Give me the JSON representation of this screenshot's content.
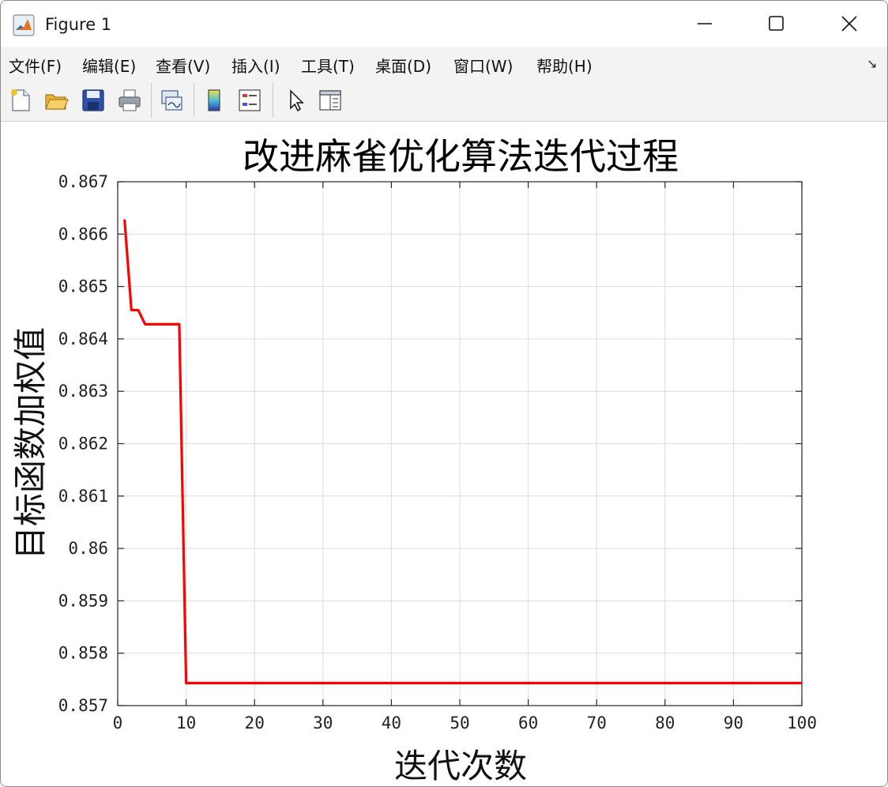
{
  "window": {
    "title": "Figure 1",
    "icon": "matlab-icon"
  },
  "menu": [
    {
      "label": "文件(F)"
    },
    {
      "label": "编辑(E)"
    },
    {
      "label": "查看(V)"
    },
    {
      "label": "插入(I)"
    },
    {
      "label": "工具(T)"
    },
    {
      "label": "桌面(D)"
    },
    {
      "label": "窗口(W)"
    },
    {
      "label": "帮助(H)"
    }
  ],
  "toolbar": [
    {
      "name": "new-figure-icon"
    },
    {
      "name": "open-file-icon"
    },
    {
      "name": "save-icon"
    },
    {
      "name": "print-icon"
    },
    {
      "name": "link-plot-icon"
    },
    {
      "name": "colorbar-icon"
    },
    {
      "name": "legend-icon"
    },
    {
      "name": "pointer-icon"
    },
    {
      "name": "property-inspector-icon"
    }
  ],
  "chart_data": {
    "type": "line",
    "title": "改进麻雀优化算法迭代过程",
    "xlabel": "迭代次数",
    "ylabel": "目标函数加权值",
    "xlim": [
      0,
      100
    ],
    "ylim": [
      0.857,
      0.867
    ],
    "xticks": [
      0,
      10,
      20,
      30,
      40,
      50,
      60,
      70,
      80,
      90,
      100
    ],
    "xtick_labels": [
      "0",
      "10",
      "20",
      "30",
      "40",
      "50",
      "60",
      "70",
      "80",
      "90",
      "100"
    ],
    "yticks": [
      0.857,
      0.858,
      0.859,
      0.86,
      0.861,
      0.862,
      0.863,
      0.864,
      0.865,
      0.866,
      0.867
    ],
    "ytick_labels": [
      "0.857",
      "0.858",
      "0.859",
      "0.86",
      "0.861",
      "0.862",
      "0.863",
      "0.864",
      "0.865",
      "0.866",
      "0.867"
    ],
    "grid": true,
    "series": [
      {
        "color": "#ff0000",
        "x": [
          1,
          2,
          3,
          4,
          5,
          6,
          7,
          8,
          9,
          10,
          20,
          30,
          40,
          50,
          60,
          70,
          80,
          90,
          100
        ],
        "y": [
          0.86628,
          0.86455,
          0.86455,
          0.86428,
          0.86428,
          0.86428,
          0.86428,
          0.86428,
          0.86428,
          0.85743,
          0.85743,
          0.85743,
          0.85743,
          0.85743,
          0.85743,
          0.85743,
          0.85743,
          0.85743,
          0.85743
        ]
      }
    ]
  }
}
